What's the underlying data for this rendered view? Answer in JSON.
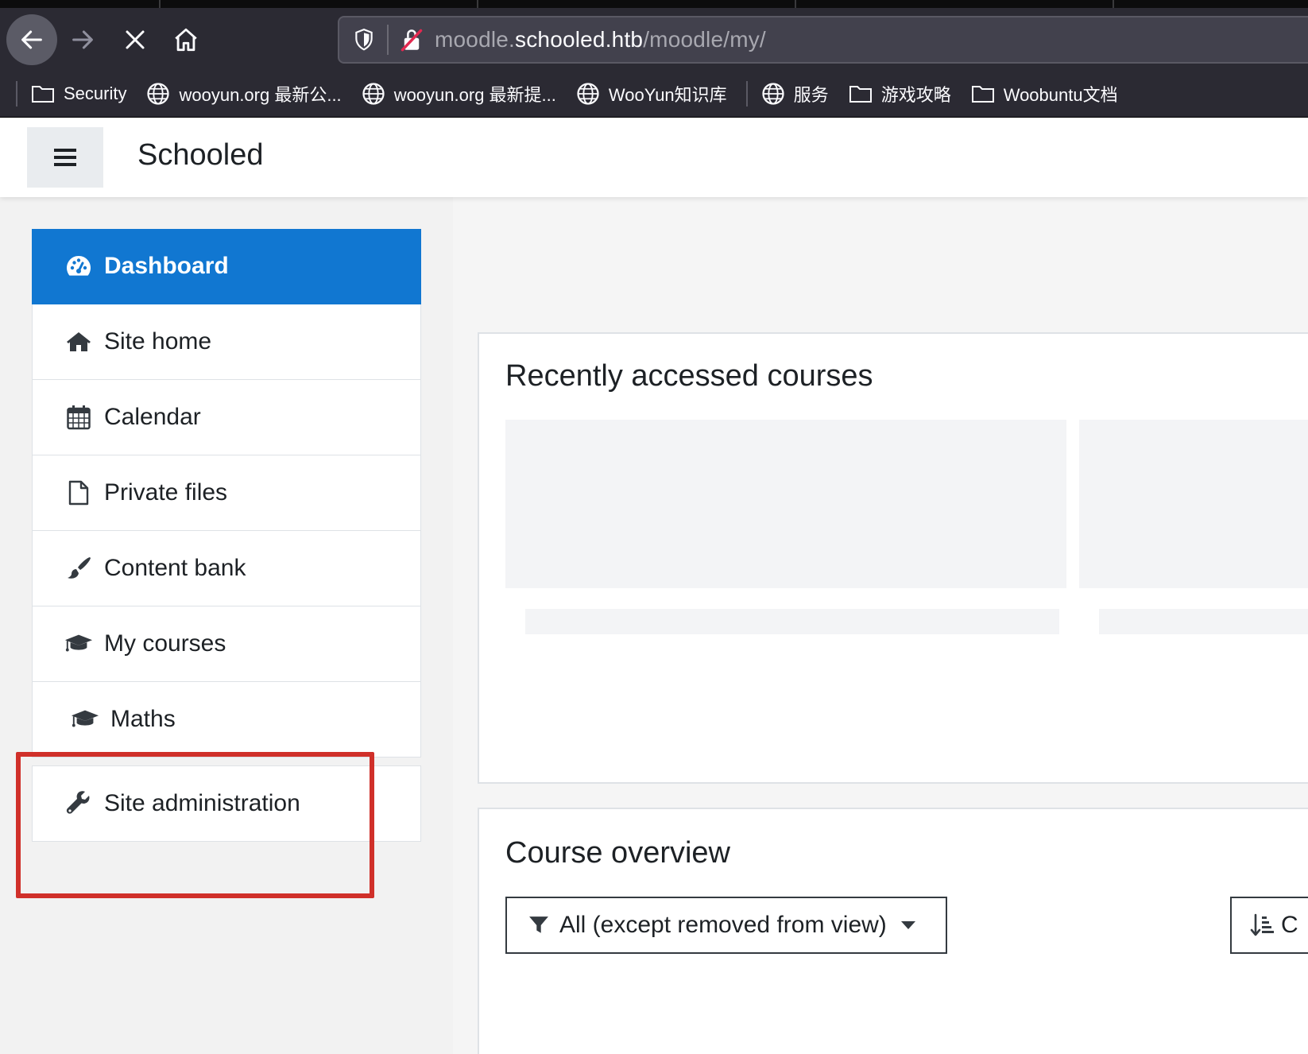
{
  "browser": {
    "url_scheme_prefix": "moodle.",
    "url_host": "schooled.htb",
    "url_path": "/moodle/my/",
    "bookmarks": [
      {
        "label": "Security",
        "icon": "folder-icon"
      },
      {
        "label": "wooyun.org 最新公...",
        "icon": "globe-icon"
      },
      {
        "label": "wooyun.org 最新提...",
        "icon": "globe-icon"
      },
      {
        "label": "WooYun知识库",
        "icon": "globe-icon"
      },
      {
        "label": "服务",
        "icon": "globe-icon"
      },
      {
        "label": "游戏攻略",
        "icon": "folder-icon"
      },
      {
        "label": "Woobuntu文档",
        "icon": "folder-icon"
      }
    ]
  },
  "header": {
    "site_name": "Schooled"
  },
  "sidebar": {
    "items": [
      {
        "label": "Dashboard",
        "icon": "dashboard-gauge-icon",
        "active": true
      },
      {
        "label": "Site home",
        "icon": "home-icon"
      },
      {
        "label": "Calendar",
        "icon": "calendar-icon"
      },
      {
        "label": "Private files",
        "icon": "file-icon"
      },
      {
        "label": "Content bank",
        "icon": "paintbrush-icon"
      },
      {
        "label": "My courses",
        "icon": "graduation-cap-icon"
      },
      {
        "label": "Maths",
        "icon": "graduation-cap-icon"
      }
    ],
    "admin": {
      "label": "Site administration",
      "icon": "wrench-icon"
    }
  },
  "main": {
    "recent_title": "Recently accessed courses",
    "overview_title": "Course overview",
    "filter_label": "All (except removed from view)",
    "sort_label": "C"
  },
  "colors": {
    "accent": "#1177d1",
    "highlight": "#d0302a",
    "chrome": "#2b2a33"
  }
}
